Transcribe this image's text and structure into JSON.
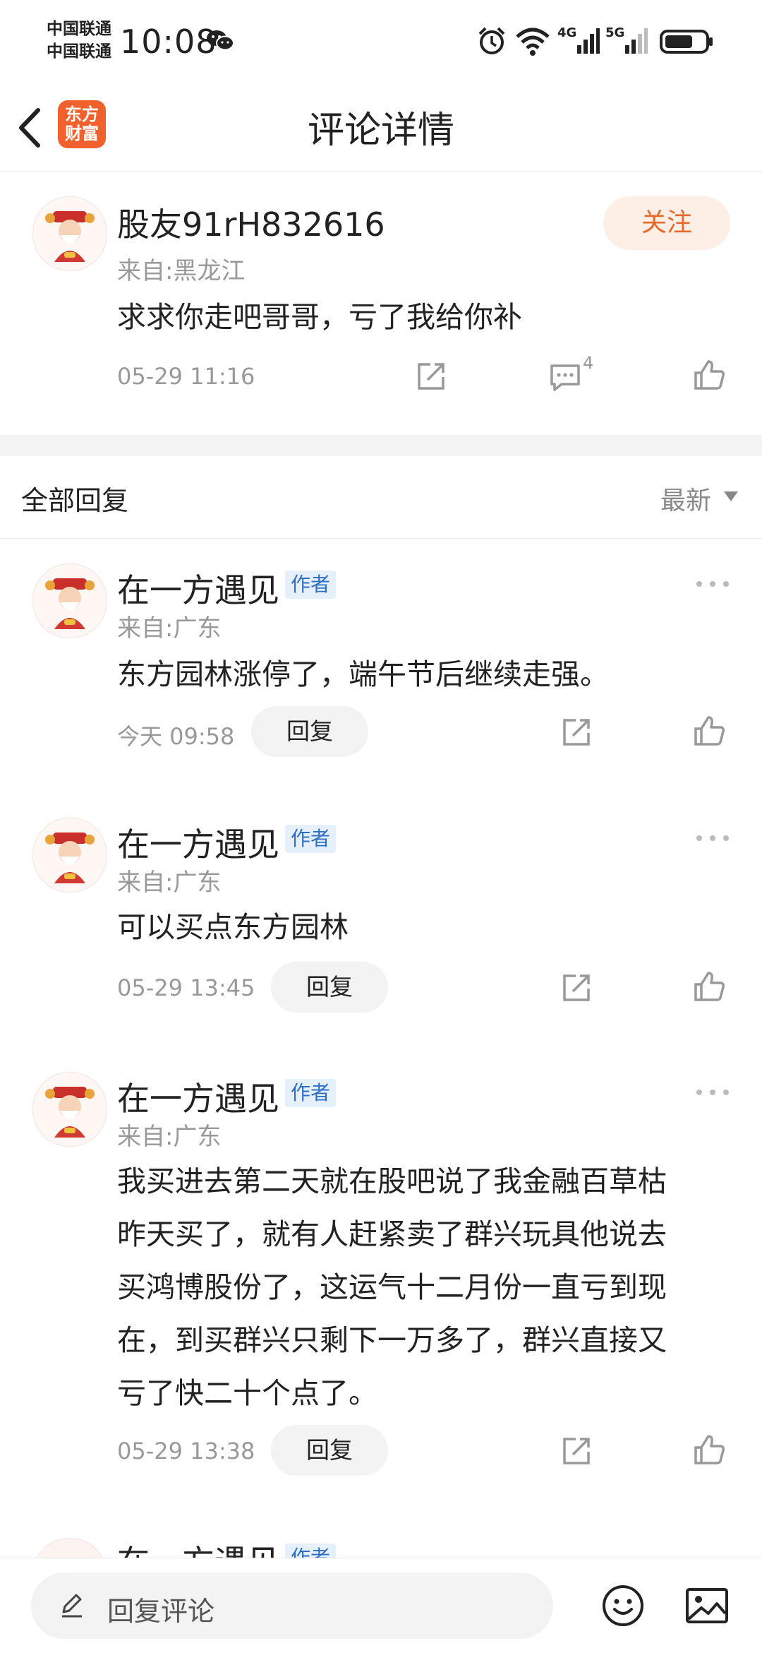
{
  "status_bar": {
    "carrier_1": "中国联通",
    "carrier_2": "中国联通",
    "time": "10:08",
    "net_4g": "4G",
    "net_5g": "5G"
  },
  "header": {
    "logo_line1": "东方",
    "logo_line2": "财富",
    "title": "评论详情"
  },
  "main_comment": {
    "username": "股友91rH832616",
    "location": "来自:黑龙江",
    "text": "求求你走吧哥哥，亏了我给你补",
    "time": "05-29 11:16",
    "comment_count": "4",
    "follow_label": "关注"
  },
  "replies_section": {
    "title": "全部回复",
    "sort_label": "最新"
  },
  "replies": [
    {
      "username": "在一方遇见",
      "tag": "作者",
      "location": "来自:广东",
      "text": "东方园林涨停了，端午节后继续走强。",
      "time": "今天 09:58",
      "reply_label": "回复"
    },
    {
      "username": "在一方遇见",
      "tag": "作者",
      "location": "来自:广东",
      "text": "可以买点东方园林",
      "time": "05-29 13:45",
      "reply_label": "回复"
    },
    {
      "username": "在一方遇见",
      "tag": "作者",
      "location": "来自:广东",
      "text_lines": [
        "我买进去第二天就在股吧说了我金融百草枯",
        "昨天买了，就有人赶紧卖了群兴玩具他说去",
        "买鸿博股份了，这运气十二月份一直亏到现",
        "在，到买群兴只剩下一万多了，群兴直接又",
        "亏了快二十个点了。"
      ],
      "time": "05-29 13:38",
      "reply_label": "回复"
    },
    {
      "username": "在一方遇见",
      "tag": "作者"
    }
  ],
  "bottom_bar": {
    "input_placeholder": "回复评论"
  },
  "colors": {
    "brand_orange": "#f0612e",
    "follow_text": "#e8692c",
    "author_tag": "#2f6fc7"
  },
  "icons": [
    "back-icon",
    "wechat-icon",
    "alarm-icon",
    "wifi-icon",
    "signal-icon",
    "battery-icon",
    "share-icon",
    "comment-icon",
    "like-icon",
    "more-icon",
    "pen-icon",
    "emoji-icon",
    "image-icon",
    "avatar-fortune-god"
  ]
}
